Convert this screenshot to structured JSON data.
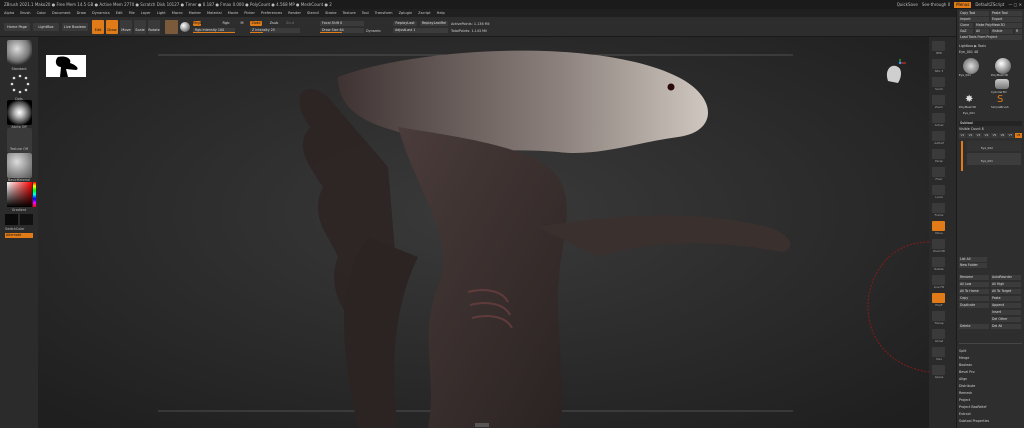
{
  "titlebar": {
    "text": "ZBrush 2021.1    Mako20   ● Free Mem 14.5 GB ● Active Mem 2770 ● Scratch Disk 10127 ● Timer ● 0.187 ● Fmax 0.000 ● PolyCount ● 4.568 MP ● MeshCount ● 2",
    "quicksave": "QuickSave",
    "seethrough": "See-through  0",
    "menus": "Menus",
    "script": "DefaultZScript"
  },
  "menubar": [
    "Alpha",
    "Brush",
    "Color",
    "Document",
    "Draw",
    "Dynamics",
    "Edit",
    "File",
    "Layer",
    "Light",
    "Macro",
    "Marker",
    "Material",
    "Movie",
    "Picker",
    "Preferences",
    "Render",
    "Stencil",
    "Stroke",
    "Texture",
    "Tool",
    "Transform",
    "Zplugin",
    "Zscript",
    "Help"
  ],
  "toolbar": {
    "home_page": "Home Page",
    "lightbox": "LightBox",
    "live_boolean": "Live Boolean",
    "edit": "Edit",
    "draw": "Draw",
    "move": "Move",
    "scale": "Scale",
    "rotate": "Rotate",
    "mrgb": "Mrgb",
    "rgb": "Rgb",
    "m": "M",
    "zadd": "Zadd",
    "zsub": "Zsub",
    "zcut": "Zcut",
    "rgb_intensity": "Rgb Intensity 100",
    "z_intensity": "Z Intensity 25",
    "focal_shift": "Focal Shift 0",
    "draw_size": "Draw Size 64",
    "dynamic": "Dynamic",
    "replay_last": "ReplayLast",
    "replay_last_rel": "ReplayLastRel",
    "adjust_last": "AdjustLast 1",
    "active_points": "ActivePoints: 1.136 Mil",
    "total_points": "TotalPoints: 1.143 Mil",
    "z_intensity_pct": 25,
    "draw_size_pct": 50
  },
  "left_shelf": {
    "standard": "Standard",
    "dots": "Dots",
    "alpha_off": "Alpha Off",
    "texture_off": "Texture Off",
    "basic_material": "BasicMaterial",
    "gradient": "Gradient",
    "switch_color": "SwitchColor",
    "alternate": "Alternate"
  },
  "right_tools": [
    "BPR",
    "SPix 3",
    "Scroll",
    "Zoom",
    "Actual",
    "AAHalf",
    "Persp",
    "Floor",
    "Local",
    "Frame",
    "Move",
    "Zoom3D",
    "Rotate",
    "Line Fill",
    "PolyF",
    "Transp",
    "Ghost",
    "Solo",
    "Xpose"
  ],
  "right_panel": {
    "header_buttons": [
      "Copy Tool",
      "Paste Tool",
      "Import",
      "Export",
      "Clone",
      "Make PolyMesh3D",
      "GoZ",
      "All",
      "Visible",
      "R"
    ],
    "load_save": "Load Tools From Project",
    "lightbox_tools": "Lightbox ▶ Tools",
    "current_tool": "Eye_001  48",
    "tool_thumbs": [
      "Eye_001",
      "PolyMesh3D",
      "Cylinder3D",
      "PolyMesh3D",
      "SimpleBrush",
      "Eye_001"
    ],
    "subtool": "Subtool",
    "visible_count": "Visible Count 8",
    "version_tabs": [
      "V1",
      "V2",
      "V3",
      "V4",
      "V5",
      "V6",
      "V7",
      "V8"
    ],
    "subtool_items": [
      "Eye_002",
      "Eye_001"
    ],
    "list_all": "List All",
    "new_folder": "New Folder",
    "rows": [
      [
        "Rename",
        "AutoReorder"
      ],
      [
        "All Low",
        "All High"
      ],
      [
        "All To Home",
        "All To Target"
      ],
      [
        "Copy",
        "Paste"
      ],
      [
        "Duplicate",
        "Append"
      ],
      [
        "",
        "Insert"
      ],
      [
        "",
        "Del Other"
      ],
      [
        "Delete",
        "Del All"
      ]
    ],
    "sub_menu": [
      "Split",
      "Merge",
      "Boolean",
      "Bevel Pro",
      "Align",
      "Distribute",
      "Remesh",
      "Project",
      "Project BasRelief",
      "Extract",
      "Subtool Properties"
    ]
  }
}
